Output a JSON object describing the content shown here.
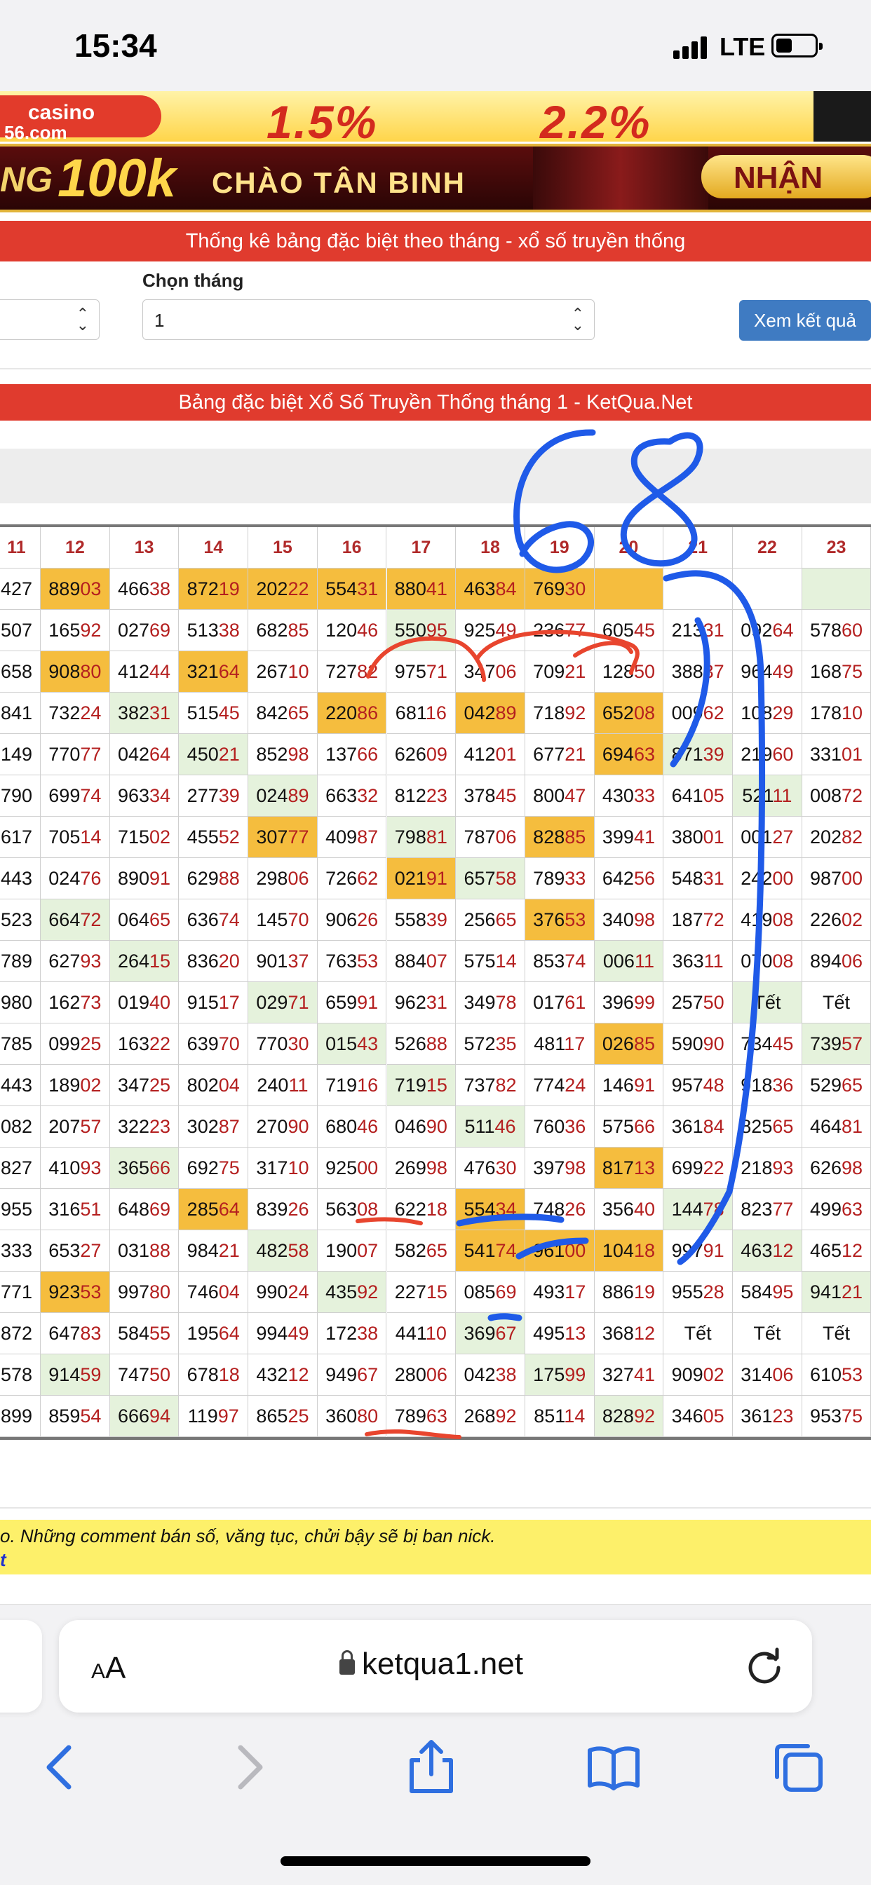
{
  "status_bar": {
    "time": "15:34",
    "network": "LTE"
  },
  "banners": {
    "top_logo_text": "casino",
    "top_logo_sub": "56.com",
    "top_left_pct": "1.5%",
    "top_right_pct": "2.2%",
    "second_prefix": "NG",
    "second_amount": "100k",
    "second_text": "CHÀO TÂN BINH",
    "second_button": "NHẬN"
  },
  "page": {
    "title_bar": "Thống kê bảng đặc biệt theo tháng - xổ số truyền thống",
    "month_label": "Chọn tháng",
    "month_value": "1",
    "submit_label": "Xem kết quả",
    "table_title": "Bảng đặc biệt Xổ Số Truyền Thống tháng 1 - KetQua.Net"
  },
  "table": {
    "columns": [
      "11",
      "12",
      "13",
      "14",
      "15",
      "16",
      "17",
      "18",
      "19",
      "20",
      "21",
      "22",
      "23"
    ],
    "rows": [
      [
        "427",
        "88903",
        "46638",
        "87219",
        "20222",
        "55431",
        "88041",
        "46384",
        "76930",
        "",
        "",
        "",
        ""
      ],
      [
        "507",
        "16592",
        "02769",
        "51338",
        "68285",
        "12046",
        "55095",
        "92549",
        "23677",
        "60545",
        "21331",
        "09264",
        "57860"
      ],
      [
        "658",
        "90880",
        "41244",
        "32164",
        "26710",
        "72782",
        "97571",
        "34706",
        "70921",
        "12850",
        "38837",
        "96449",
        "16875"
      ],
      [
        "841",
        "73224",
        "38231",
        "51545",
        "84265",
        "22086",
        "68116",
        "04289",
        "71892",
        "65208",
        "00962",
        "10829",
        "17810"
      ],
      [
        "149",
        "77077",
        "04264",
        "45021",
        "85298",
        "13766",
        "62609",
        "41201",
        "67721",
        "69463",
        "87139",
        "21960",
        "33101"
      ],
      [
        "790",
        "69974",
        "96334",
        "27739",
        "02489",
        "66332",
        "81223",
        "37845",
        "80047",
        "43033",
        "64105",
        "52111",
        "00872"
      ],
      [
        "617",
        "70514",
        "71502",
        "45552",
        "30777",
        "40987",
        "79881",
        "78706",
        "82885",
        "39941",
        "38001",
        "00127",
        "20282"
      ],
      [
        "443",
        "02476",
        "89091",
        "62988",
        "29806",
        "72662",
        "02191",
        "65758",
        "78933",
        "64256",
        "54831",
        "24200",
        "98700"
      ],
      [
        "523",
        "66472",
        "06465",
        "63674",
        "14570",
        "90626",
        "55839",
        "25665",
        "37653",
        "34098",
        "18772",
        "41908",
        "22602"
      ],
      [
        "789",
        "62793",
        "26415",
        "83620",
        "90137",
        "76353",
        "88407",
        "57514",
        "85374",
        "00611",
        "36311",
        "07008",
        "89406"
      ],
      [
        "980",
        "16273",
        "01940",
        "91517",
        "02971",
        "65991",
        "96231",
        "34978",
        "01761",
        "39699",
        "25750",
        "Tết",
        "Tết"
      ],
      [
        "785",
        "09925",
        "16322",
        "63970",
        "77030",
        "01543",
        "52688",
        "57235",
        "48117",
        "02685",
        "59090",
        "73445",
        "73957"
      ],
      [
        "443",
        "18902",
        "34725",
        "80204",
        "24011",
        "71916",
        "71915",
        "73782",
        "77424",
        "14691",
        "95748",
        "91836",
        "52965"
      ],
      [
        "082",
        "20757",
        "32223",
        "30287",
        "27090",
        "68046",
        "04690",
        "51146",
        "76036",
        "57566",
        "36184",
        "82565",
        "46481"
      ],
      [
        "827",
        "41093",
        "36566",
        "69275",
        "31710",
        "92500",
        "26998",
        "47630",
        "39798",
        "81713",
        "69922",
        "21893",
        "62698"
      ],
      [
        "955",
        "31651",
        "64869",
        "28564",
        "83926",
        "56308",
        "62218",
        "55434",
        "74826",
        "35640",
        "14478",
        "82377",
        "49963"
      ],
      [
        "333",
        "65327",
        "03188",
        "98421",
        "48258",
        "19007",
        "58265",
        "54174",
        "96100",
        "10418",
        "99791",
        "46312",
        "46512"
      ],
      [
        "771",
        "92353",
        "99780",
        "74604",
        "99024",
        "43592",
        "22715",
        "08569",
        "49317",
        "88619",
        "95528",
        "58495",
        "94121"
      ],
      [
        "872",
        "64783",
        "58455",
        "19564",
        "99449",
        "17238",
        "44110",
        "36967",
        "49513",
        "36812",
        "Tết",
        "Tết",
        "Tết"
      ],
      [
        "578",
        "91459",
        "74750",
        "67818",
        "43212",
        "94967",
        "28006",
        "04238",
        "17599",
        "32741",
        "90902",
        "31406",
        "61053"
      ],
      [
        "899",
        "85954",
        "66694",
        "11997",
        "86525",
        "36080",
        "78963",
        "26892",
        "85114",
        "82892",
        "34605",
        "36123",
        "95375"
      ]
    ],
    "highlights": {
      "yellow": [
        [
          0,
          1
        ],
        [
          0,
          3
        ],
        [
          0,
          4
        ],
        [
          0,
          5
        ],
        [
          0,
          6
        ],
        [
          0,
          7
        ],
        [
          0,
          8
        ],
        [
          0,
          9
        ],
        [
          2,
          1
        ],
        [
          2,
          3
        ],
        [
          3,
          5
        ],
        [
          3,
          7
        ],
        [
          3,
          9
        ],
        [
          4,
          9
        ],
        [
          6,
          4
        ],
        [
          6,
          8
        ],
        [
          7,
          6
        ],
        [
          8,
          8
        ],
        [
          11,
          9
        ],
        [
          14,
          9
        ],
        [
          15,
          3
        ],
        [
          15,
          7
        ],
        [
          16,
          7
        ],
        [
          16,
          8
        ],
        [
          16,
          9
        ],
        [
          17,
          1
        ]
      ],
      "green": [
        [
          0,
          12
        ],
        [
          1,
          6
        ],
        [
          3,
          2
        ],
        [
          4,
          3
        ],
        [
          4,
          10
        ],
        [
          5,
          4
        ],
        [
          5,
          11
        ],
        [
          6,
          6
        ],
        [
          7,
          7
        ],
        [
          8,
          1
        ],
        [
          9,
          2
        ],
        [
          9,
          9
        ],
        [
          10,
          4
        ],
        [
          10,
          11
        ],
        [
          11,
          5
        ],
        [
          11,
          12
        ],
        [
          12,
          6
        ],
        [
          13,
          7
        ],
        [
          14,
          2
        ],
        [
          15,
          10
        ],
        [
          16,
          4
        ],
        [
          16,
          11
        ],
        [
          17,
          5
        ],
        [
          17,
          12
        ],
        [
          18,
          7
        ],
        [
          19,
          1
        ],
        [
          19,
          8
        ],
        [
          20,
          2
        ],
        [
          20,
          9
        ]
      ]
    },
    "annotations": {
      "handwritten_numbers": [
        "68"
      ],
      "pen_colors": [
        "#1f5ae8",
        "#e8452e"
      ]
    }
  },
  "notice": {
    "line1": "o. Những comment bán số, văng tục, chửi bậy sẽ bị ban nick.",
    "line2": "t"
  },
  "browser": {
    "text_size_label": "AA",
    "url": "ketqua1.net"
  },
  "colors": {
    "red_bar": "#e03b2e",
    "yellow_cell": "#f5bd3e",
    "green_cell": "#e5f2dc",
    "button_blue": "#3f7bc2"
  },
  "icons": [
    "signal-icon",
    "battery-icon",
    "chevron-updown-icon",
    "lock-icon",
    "reload-icon",
    "back-icon",
    "forward-icon",
    "share-icon",
    "bookmarks-icon",
    "tabs-icon"
  ]
}
